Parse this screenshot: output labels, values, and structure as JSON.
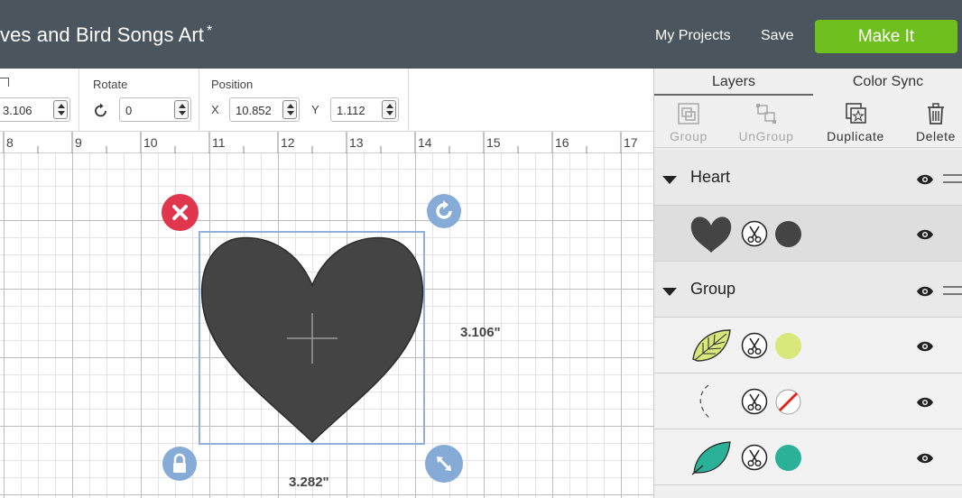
{
  "header": {
    "title": "ves and Bird Songs Art",
    "unsaved_marker": "*",
    "my_projects_label": "My Projects",
    "save_label": "Save",
    "make_it_label": "Make It",
    "make_it_color": "#6fbf1e",
    "bar_color": "#4a555d"
  },
  "edit_bar": {
    "size_h_value": "3.106",
    "rotate_label": "Rotate",
    "rotate_value": "0",
    "position_label": "Position",
    "x_label": "X",
    "x_value": "10.852",
    "y_label": "Y",
    "y_value": "1.112"
  },
  "ruler": {
    "ticks": [
      "8",
      "9",
      "10",
      "11",
      "12",
      "13",
      "14",
      "15",
      "16",
      "17"
    ]
  },
  "canvas": {
    "selected_shape": "heart",
    "shape_color": "#444444",
    "height_label": "3.106\"",
    "width_label": "3.282\"",
    "handles": {
      "delete": "close-icon",
      "rotate": "rotate-icon",
      "lock": "lock-icon",
      "resize": "resize-icon"
    },
    "delete_color": "#e0364e",
    "handle_color": "#86abd6"
  },
  "panel": {
    "tabs": [
      {
        "label": "Layers",
        "active": true
      },
      {
        "label": "Color Sync",
        "active": false
      }
    ],
    "tools": {
      "group": "Group",
      "ungroup": "UnGroup",
      "duplicate": "Duplicate",
      "delete": "Delete"
    },
    "layers": [
      {
        "group_name": "Heart",
        "items": [
          {
            "thumb": "heart-icon",
            "op": "cut",
            "color": "#444444",
            "selected": true
          }
        ]
      },
      {
        "group_name": "Group",
        "items": [
          {
            "thumb": "leaf-icon",
            "op": "cut",
            "color": "#d8e87a"
          },
          {
            "thumb": "arc-icon",
            "op": "cut",
            "color": "none"
          },
          {
            "thumb": "leaf-teal-icon",
            "op": "cut",
            "color": "#2bb198"
          }
        ]
      }
    ]
  }
}
